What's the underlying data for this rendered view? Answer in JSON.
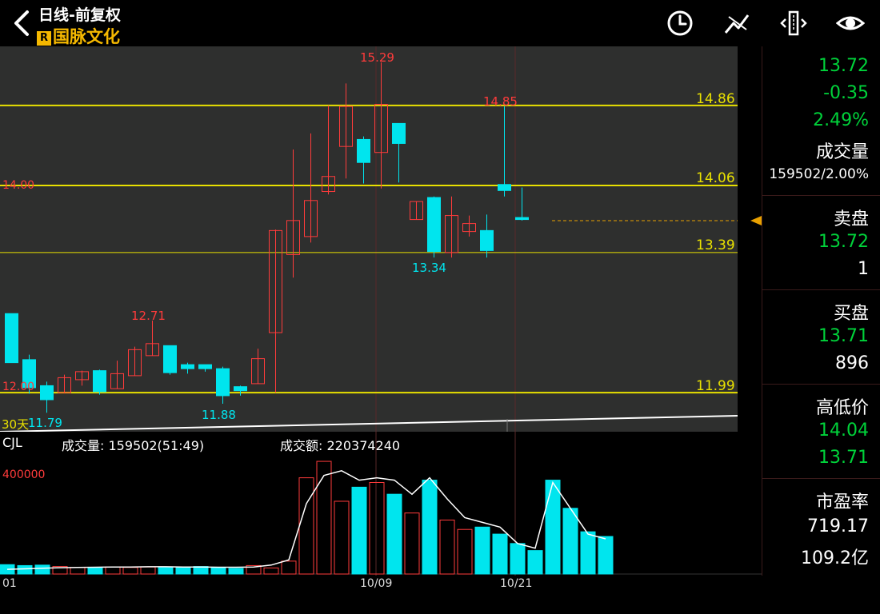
{
  "header": {
    "title": "日线-前复权",
    "badge": "R",
    "stock_name": "国脉文化"
  },
  "toolbar": {
    "icons": [
      "clock-icon",
      "draw-line-icon",
      "split-adjust-icon",
      "eye-icon"
    ]
  },
  "price_panel": {
    "level_lines": [
      {
        "value": 14.86,
        "label": "14.86"
      },
      {
        "value": 14.06,
        "label": "14.06"
      },
      {
        "value": 13.39,
        "label": "13.39"
      },
      {
        "value": 11.99,
        "label": "11.99"
      }
    ],
    "axis_left_labels": [
      "14.00",
      "12.00"
    ],
    "extreme_labels": [
      "15.29",
      "14.85",
      "13.34",
      "12.71",
      "11.88",
      "11.79"
    ],
    "period_label": "30天",
    "colors": {
      "up": "#ff3b3b",
      "down": "#00e5ee",
      "level": "#e8e000",
      "bg": "#2e2f2e"
    }
  },
  "volume_panel": {
    "indicator": "CJL",
    "volume_text": "成交量: 159502(51:49)",
    "amount_text": "成交额: 220374240",
    "scale_label": "400000",
    "date_labels": [
      "01",
      "10/09",
      "10/21"
    ]
  },
  "side_panel": {
    "last": "13.72",
    "change": "-0.35",
    "change_pct": "2.49%",
    "volume_title": "成交量",
    "volume_value": "159502/2.00%",
    "ask_title": "卖盘",
    "ask_price": "13.72",
    "ask_qty": "1",
    "bid_title": "买盘",
    "bid_price": "13.71",
    "bid_qty": "896",
    "hl_title": "高低价",
    "high": "14.04",
    "low": "13.71",
    "pe_title": "市盈率",
    "pe_value": "719.17",
    "mcap": "109.2亿"
  },
  "chart_data": {
    "type": "candlestick",
    "y_range": [
      11.6,
      15.45
    ],
    "candles": [
      {
        "o": 12.78,
        "c": 12.29,
        "h": 12.78,
        "l": 12.29
      },
      {
        "o": 12.32,
        "c": 12.04,
        "h": 12.37,
        "l": 11.98
      },
      {
        "o": 12.06,
        "c": 11.92,
        "h": 12.1,
        "l": 11.79
      },
      {
        "o": 11.99,
        "c": 12.14,
        "h": 12.17,
        "l": 11.99
      },
      {
        "o": 12.12,
        "c": 12.2,
        "h": 12.21,
        "l": 12.06
      },
      {
        "o": 12.21,
        "c": 12.0,
        "h": 12.22,
        "l": 11.97
      },
      {
        "o": 12.03,
        "c": 12.18,
        "h": 12.31,
        "l": 12.03
      },
      {
        "o": 12.16,
        "c": 12.42,
        "h": 12.45,
        "l": 12.16
      },
      {
        "o": 12.36,
        "c": 12.48,
        "h": 12.71,
        "l": 12.36
      },
      {
        "o": 12.46,
        "c": 12.19,
        "h": 12.46,
        "l": 12.17
      },
      {
        "o": 12.27,
        "c": 12.23,
        "h": 12.29,
        "l": 12.18
      },
      {
        "o": 12.27,
        "c": 12.23,
        "h": 12.27,
        "l": 12.2
      },
      {
        "o": 12.23,
        "c": 11.96,
        "h": 12.25,
        "l": 11.88
      },
      {
        "o": 12.05,
        "c": 12.01,
        "h": 12.06,
        "l": 11.96
      },
      {
        "o": 12.08,
        "c": 12.33,
        "h": 12.43,
        "l": 12.08
      },
      {
        "o": 12.59,
        "c": 13.61,
        "h": 13.62,
        "l": 11.99
      },
      {
        "o": 13.37,
        "c": 13.71,
        "h": 14.42,
        "l": 13.14
      },
      {
        "o": 13.55,
        "c": 13.91,
        "h": 14.58,
        "l": 13.49
      },
      {
        "o": 14.0,
        "c": 14.15,
        "h": 14.86,
        "l": 13.97
      },
      {
        "o": 14.45,
        "c": 14.85,
        "h": 15.08,
        "l": 14.13
      },
      {
        "o": 14.52,
        "c": 14.29,
        "h": 14.55,
        "l": 14.08
      },
      {
        "o": 14.39,
        "c": 14.87,
        "h": 15.29,
        "l": 14.03
      },
      {
        "o": 14.68,
        "c": 14.48,
        "h": 14.68,
        "l": 14.09
      },
      {
        "o": 13.72,
        "c": 13.9,
        "h": 13.9,
        "l": 13.72
      },
      {
        "o": 13.94,
        "c": 13.4,
        "h": 13.95,
        "l": 13.34
      },
      {
        "o": 13.39,
        "c": 13.76,
        "h": 13.95,
        "l": 13.34
      },
      {
        "o": 13.6,
        "c": 13.68,
        "h": 13.76,
        "l": 13.55
      },
      {
        "o": 13.61,
        "c": 13.41,
        "h": 13.77,
        "l": 13.34
      },
      {
        "o": 14.07,
        "c": 14.01,
        "h": 14.85,
        "l": 13.95
      },
      {
        "o": 13.74,
        "c": 13.72,
        "h": 14.04,
        "l": 13.71
      }
    ],
    "volumes": [
      40000,
      36000,
      38000,
      32000,
      28000,
      28000,
      30000,
      28000,
      30000,
      30000,
      30000,
      32000,
      26000,
      24000,
      36000,
      26000,
      55000,
      410000,
      480000,
      310000,
      370000,
      390000,
      340000,
      260000,
      400000,
      230000,
      190000,
      200000,
      170000,
      130000,
      100000,
      400000,
      280000,
      180000,
      160000
    ],
    "volume_ma": [
      20000,
      22000,
      25000,
      27000,
      28000,
      29000,
      30000,
      30000,
      31000,
      31000,
      30000,
      30000,
      29000,
      29000,
      30000,
      38000,
      60000,
      300000,
      420000,
      440000,
      400000,
      410000,
      400000,
      340000,
      410000,
      320000,
      240000,
      220000,
      200000,
      130000,
      110000,
      390000,
      280000,
      170000,
      150000
    ],
    "volume_range": [
      0,
      470000
    ]
  }
}
